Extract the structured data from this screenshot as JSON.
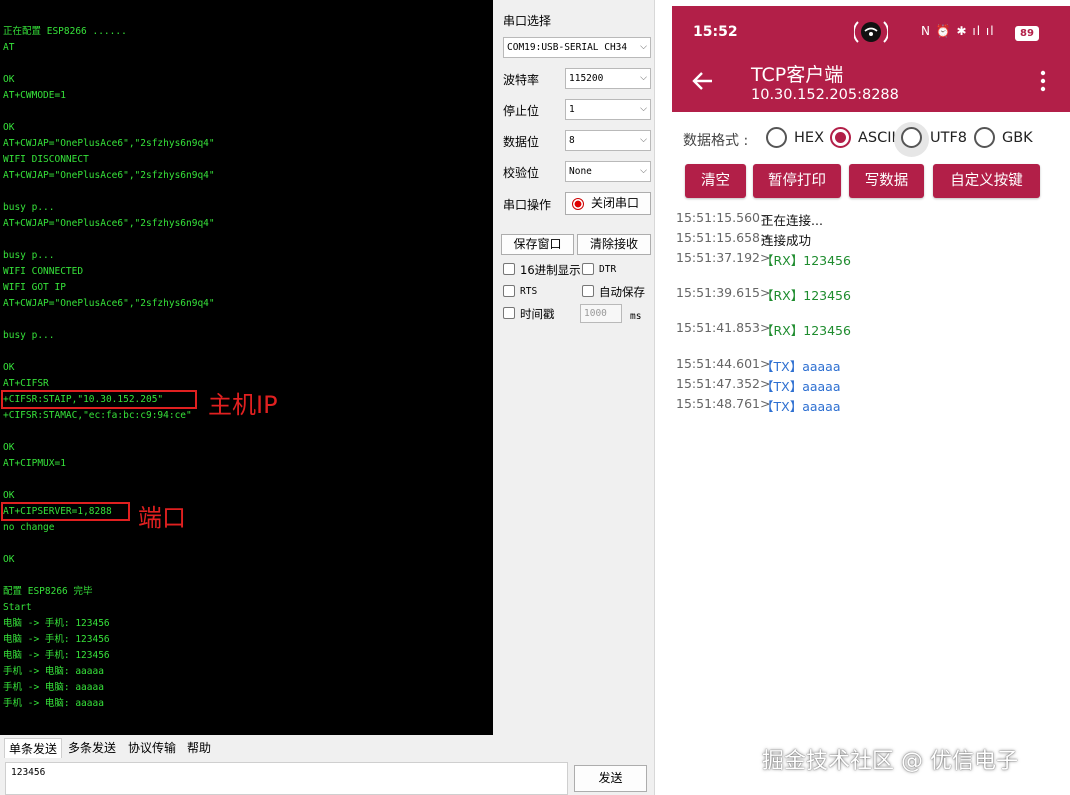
{
  "terminal": {
    "lines": [
      "正在配置 ESP8266 ......",
      "AT",
      "",
      "OK",
      "AT+CWMODE=1",
      "",
      "OK",
      "AT+CWJAP=\"OnePlusAce6\",\"2sfzhys6n9q4\"",
      "WIFI DISCONNECT",
      "AT+CWJAP=\"OnePlusAce6\",\"2sfzhys6n9q4\"",
      "",
      "busy p...",
      "AT+CWJAP=\"OnePlusAce6\",\"2sfzhys6n9q4\"",
      "",
      "busy p...",
      "WIFI CONNECTED",
      "WIFI GOT IP",
      "AT+CWJAP=\"OnePlusAce6\",\"2sfzhys6n9q4\"",
      "",
      "busy p...",
      "",
      "OK",
      "AT+CIFSR",
      "+CIFSR:STAIP,\"10.30.152.205\"",
      "+CIFSR:STAMAC,\"ec:fa:bc:c9:94:ce\"",
      "",
      "OK",
      "AT+CIPMUX=1",
      "",
      "OK",
      "AT+CIPSERVER=1,8288",
      "no change",
      "",
      "OK",
      "",
      "配置 ESP8266 完毕",
      "Start",
      "电脑 -> 手机: 123456",
      "电脑 -> 手机: 123456",
      "电脑 -> 手机: 123456",
      "手机 -> 电脑: aaaaa",
      "手机 -> 电脑: aaaaa",
      "手机 -> 电脑: aaaaa"
    ],
    "annotations": {
      "host_ip": "主机IP",
      "port": "端口"
    }
  },
  "settings": {
    "port_label": "串口选择",
    "port_value": "COM19:USB-SERIAL CH34",
    "baud_label": "波特率",
    "baud_value": "115200",
    "stop_label": "停止位",
    "stop_value": "1",
    "data_label": "数据位",
    "data_value": "8",
    "parity_label": "校验位",
    "parity_value": "None",
    "op_label": "串口操作",
    "close_button": "关闭串口",
    "save_window": "保存窗口",
    "clear_recv": "清除接收",
    "hex_display": "16进制显示",
    "dtr": "DTR",
    "rts": "RTS",
    "auto_save": "自动保存",
    "timestamp": "时间戳",
    "interval_value": "1000",
    "interval_unit": "ms"
  },
  "send": {
    "tabs": [
      "单条发送",
      "多条发送",
      "协议传输",
      "帮助"
    ],
    "input_value": "123456",
    "send_button": "发送"
  },
  "phone": {
    "time": "15:52",
    "status_icons": "N ⏰ ✱ ıl ıl",
    "battery": "89",
    "title": "TCP客户端",
    "subtitle": "10.30.152.205:8288",
    "format_label": "数据格式 :",
    "formats": [
      "HEX",
      "ASCII",
      "UTF8",
      "GBK"
    ],
    "selected_format": "ASCII",
    "buttons": [
      "清空",
      "暂停打印",
      "写数据",
      "自定义按键"
    ],
    "log": [
      {
        "time": "15:51:15.560>",
        "msg": "正在连接...",
        "kind": "sys"
      },
      {
        "time": "15:51:15.658>",
        "msg": "连接成功",
        "kind": "sys"
      },
      {
        "time": "15:51:37.192>",
        "msg": "【RX】123456",
        "kind": "rx"
      },
      {
        "time": "15:51:39.615>",
        "msg": "【RX】123456",
        "kind": "rx"
      },
      {
        "time": "15:51:41.853>",
        "msg": "【RX】123456",
        "kind": "rx"
      },
      {
        "time": "15:51:44.601>",
        "msg": "【TX】aaaaa",
        "kind": "tx"
      },
      {
        "time": "15:51:47.352>",
        "msg": "【TX】aaaaa",
        "kind": "tx"
      },
      {
        "time": "15:51:48.761>",
        "msg": "【TX】aaaaa",
        "kind": "tx"
      }
    ]
  },
  "watermark": "掘金技术社区 @ 优信电子",
  "colors": {
    "accent": "#b21f48",
    "terminal_text": "#36e23a",
    "rx": "#1e8c2e",
    "tx": "#2d6fd1",
    "highlight": "#e02020"
  }
}
